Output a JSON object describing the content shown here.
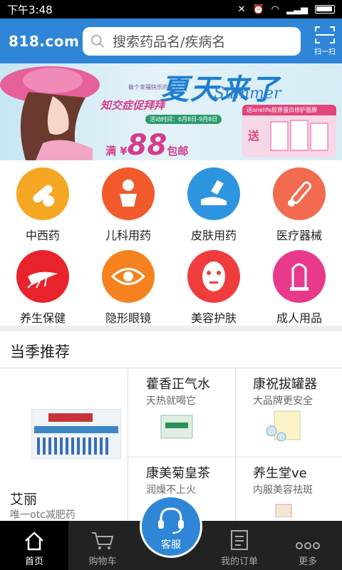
{
  "status": {
    "time": "下午3:48"
  },
  "header": {
    "logo": "818.com",
    "search_placeholder": "搜索药品名/疾病名",
    "scan_label": "扫一扫"
  },
  "banner": {
    "title": "夏天来了",
    "subtitle": "Summer",
    "slogan_small": "做个幸福快乐的女人",
    "slogan": "知交症促拜拜",
    "period": "活动时间：6月8日-9月8日",
    "price_prefix": "满 ¥",
    "price": "88",
    "price_suffix": "包邮",
    "promo": "送onelife胶原蛋白修护面膜",
    "gift": "送"
  },
  "categories": [
    {
      "label": "中西药",
      "color": "#f5a623",
      "icon": "pill-icon"
    },
    {
      "label": "儿科用药",
      "color": "#f15a2b",
      "icon": "baby-icon"
    },
    {
      "label": "皮肤用药",
      "color": "#2d95e0",
      "icon": "skin-cream-icon"
    },
    {
      "label": "医疗器械",
      "color": "#f26a4f",
      "icon": "thermometer-icon"
    },
    {
      "label": "养生保健",
      "color": "#e8232b",
      "icon": "ginseng-icon"
    },
    {
      "label": "隐形眼镜",
      "color": "#f5821f",
      "icon": "eye-icon"
    },
    {
      "label": "美容护肤",
      "color": "#ef3d3d",
      "icon": "face-mask-icon"
    },
    {
      "label": "成人用品",
      "color": "#e8398b",
      "icon": "condom-icon"
    }
  ],
  "recommend": {
    "title": "当季推荐",
    "featured": {
      "name": "艾丽",
      "desc": "唯一otc减肥药"
    },
    "products": [
      {
        "name": "藿香正气水",
        "desc": "天热就喝它"
      },
      {
        "name": "康祝拔罐器",
        "desc": "大品牌更安全"
      },
      {
        "name": "康美菊皇茶",
        "desc": "润燥不上火"
      },
      {
        "name": "养生堂ve",
        "desc": "内服美容祛斑"
      }
    ]
  },
  "tabs": [
    {
      "label": "首页",
      "icon": "home-icon"
    },
    {
      "label": "购物车",
      "icon": "cart-icon"
    },
    {
      "label": "客服",
      "icon": "headset-icon"
    },
    {
      "label": "我的订单",
      "icon": "order-icon"
    },
    {
      "label": "更多",
      "icon": "more-icon"
    }
  ],
  "colors": {
    "primary": "#2f86d6",
    "tabbar": "#222222"
  }
}
